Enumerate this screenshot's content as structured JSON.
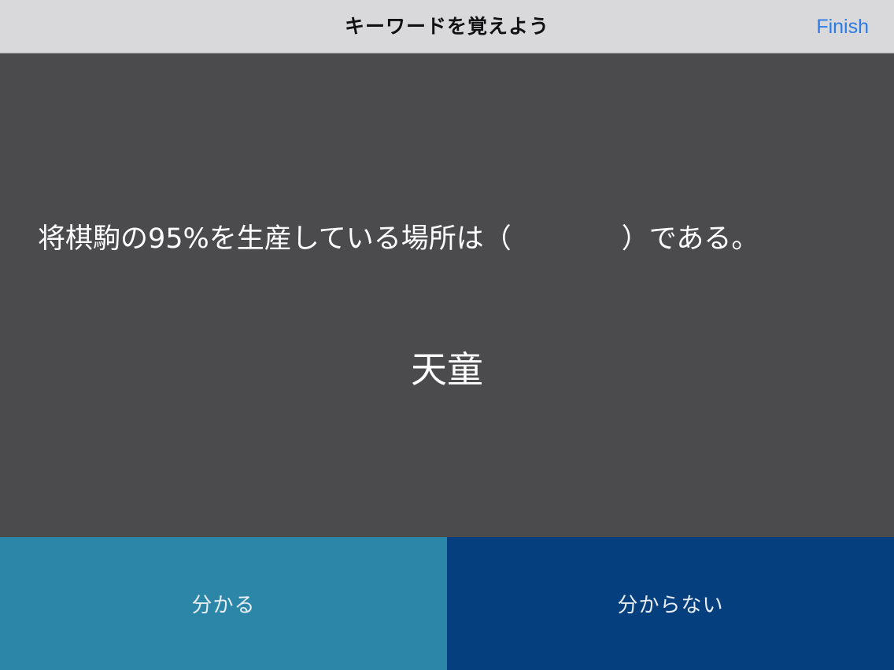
{
  "navbar": {
    "title": "キーワードを覚えよう",
    "finish_label": "Finish"
  },
  "card": {
    "question": "将棋駒の95%を生産している場所は（　　　　）である。",
    "answer": "天童"
  },
  "actions": {
    "know_label": "分かる",
    "dont_know_label": "分からない"
  },
  "colors": {
    "navbar_bg": "#d9d9db",
    "card_bg": "#4b4a4d",
    "accent_blue": "#2c7be5",
    "know_button": "#2b86a8",
    "dont_know_button": "#063f7e"
  }
}
